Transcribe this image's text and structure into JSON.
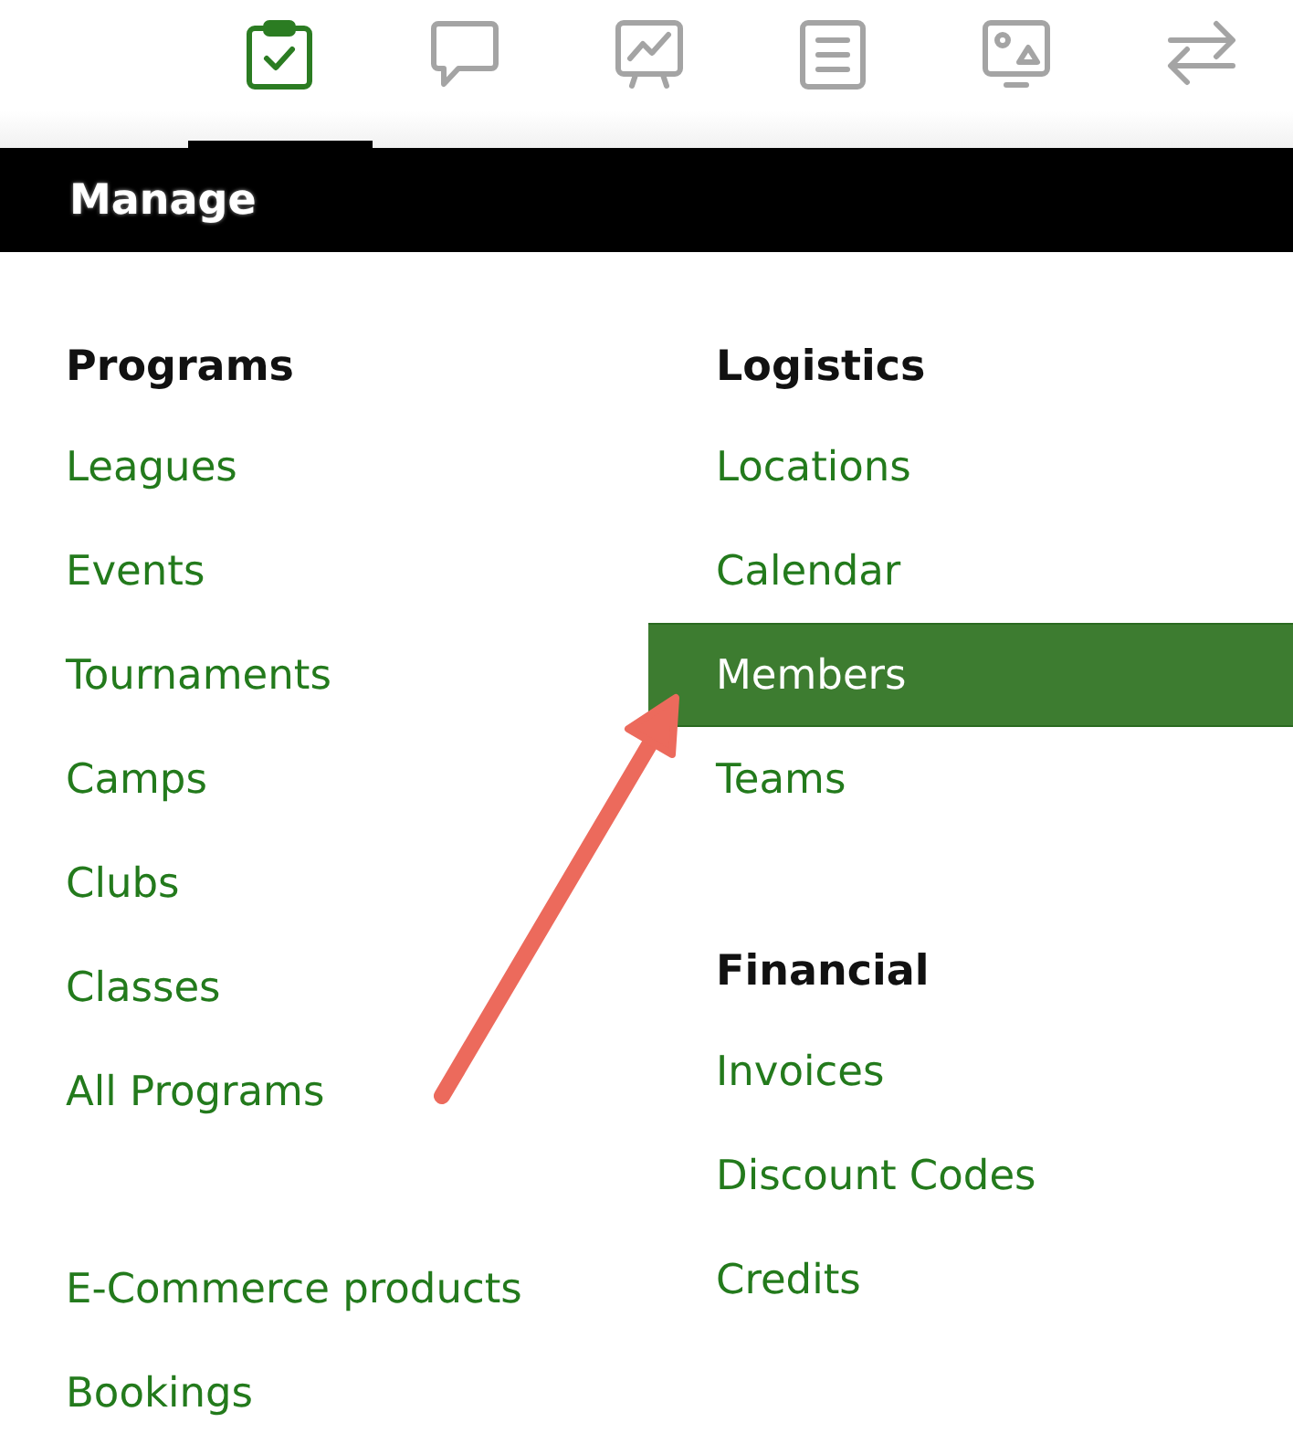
{
  "toolbar": {
    "tabs": [
      {
        "selected": true
      },
      {
        "selected": false
      },
      {
        "selected": false
      },
      {
        "selected": false
      },
      {
        "selected": false
      },
      {
        "selected": false
      }
    ]
  },
  "header": {
    "title": "Manage"
  },
  "menu": {
    "columns": [
      {
        "groups": [
          {
            "heading": "Programs",
            "items": [
              {
                "label": "Leagues",
                "selected": false
              },
              {
                "label": "Events",
                "selected": false
              },
              {
                "label": "Tournaments",
                "selected": false
              },
              {
                "label": "Camps",
                "selected": false
              },
              {
                "label": "Clubs",
                "selected": false
              },
              {
                "label": "Classes",
                "selected": false
              },
              {
                "label": "All Programs",
                "selected": false
              }
            ]
          },
          {
            "items": [
              {
                "label": "E-Commerce products",
                "selected": false
              },
              {
                "label": "Bookings",
                "selected": false
              }
            ]
          }
        ]
      },
      {
        "groups": [
          {
            "heading": "Logistics",
            "items": [
              {
                "label": "Locations",
                "selected": false
              },
              {
                "label": "Calendar",
                "selected": false
              },
              {
                "label": "Members",
                "selected": true
              },
              {
                "label": "Teams",
                "selected": false
              }
            ]
          },
          {
            "heading": "Financial",
            "items": [
              {
                "label": "Invoices",
                "selected": false
              },
              {
                "label": "Discount Codes",
                "selected": false
              },
              {
                "label": "Credits",
                "selected": false
              }
            ]
          }
        ]
      }
    ]
  }
}
